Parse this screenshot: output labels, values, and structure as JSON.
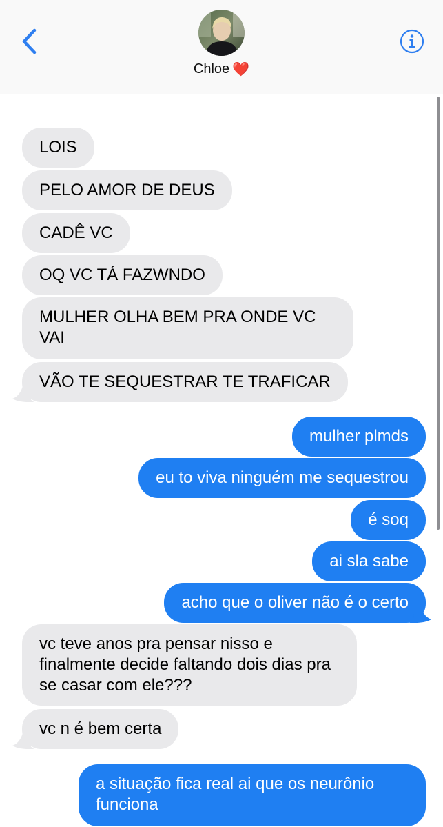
{
  "header": {
    "contact_name": "Chloe",
    "contact_emoji": "❤️",
    "back_icon": "chevron-left-icon",
    "info_icon": "info-icon"
  },
  "messages": [
    {
      "direction": "incoming",
      "text": "LOIS"
    },
    {
      "direction": "incoming",
      "text": "PELO AMOR DE DEUS"
    },
    {
      "direction": "incoming",
      "text": "CADÊ VC"
    },
    {
      "direction": "incoming",
      "text": "OQ VC TÁ FAZWNDO"
    },
    {
      "direction": "incoming",
      "text": "MULHER OLHA BEM PRA ONDE VC VAI"
    },
    {
      "direction": "incoming",
      "text": "VÃO TE SEQUESTRAR TE TRAFICAR"
    },
    {
      "direction": "outgoing",
      "text": "mulher plmds"
    },
    {
      "direction": "outgoing",
      "text": "eu to viva ninguém me sequestrou"
    },
    {
      "direction": "outgoing",
      "text": "é soq"
    },
    {
      "direction": "outgoing",
      "text": "ai sla sabe"
    },
    {
      "direction": "outgoing",
      "text": "acho que o oliver não é o certo"
    },
    {
      "direction": "incoming",
      "text": "vc teve anos pra pensar nisso e finalmente decide faltando dois dias pra se casar com ele???"
    },
    {
      "direction": "incoming",
      "text": "vc n é bem certa"
    },
    {
      "direction": "outgoing",
      "text": "a situação fica real ai que os neurônio funciona"
    }
  ],
  "colors": {
    "incoming_bubble": "#e9e9eb",
    "outgoing_bubble": "#1f7ff2",
    "accent": "#2f7ff0"
  }
}
